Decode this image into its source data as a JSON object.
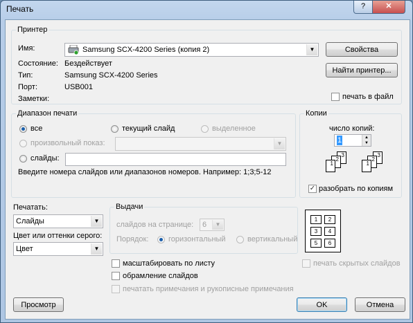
{
  "window": {
    "title": "Печать",
    "help_glyph": "?",
    "close_glyph": "✕"
  },
  "printer": {
    "legend": "Принтер",
    "name_label": "Имя:",
    "name_value": "Samsung SCX-4200 Series (копия 2)",
    "properties_button": "Свойства",
    "find_button": "Найти принтер...",
    "status_label": "Состояние:",
    "status_value": "Бездействует",
    "type_label": "Тип:",
    "type_value": "Samsung SCX-4200 Series",
    "port_label": "Порт:",
    "port_value": "USB001",
    "notes_label": "Заметки:",
    "print_to_file": "печать в файл"
  },
  "range": {
    "legend": "Диапазон печати",
    "all": "все",
    "current_slide": "текущий слайд",
    "selection": "выделенное",
    "custom_show": "произвольный показ:",
    "slides": "слайды:",
    "hint": "Введите номера слайдов или диапазонов номеров. Например: 1;3;5-12"
  },
  "copies": {
    "legend": "Копии",
    "count_label": "число копий:",
    "count_value": "1",
    "collate": "разобрать по копиям"
  },
  "print_what": {
    "label": "Печатать:",
    "value": "Слайды"
  },
  "color": {
    "label": "Цвет или оттенки серого:",
    "value": "Цвет"
  },
  "handouts": {
    "legend": "Выдачи",
    "per_page_label": "слайдов на странице:",
    "per_page_value": "6",
    "order_label": "Порядок:",
    "horizontal": "горизонтальный",
    "vertical": "вертикальный",
    "preview_numbers": [
      "1",
      "2",
      "3",
      "4",
      "5",
      "6"
    ]
  },
  "options": {
    "scale_to_fit": "масштабировать по листу",
    "frame_slides": "обрамление слайдов",
    "print_comments": "печатать примечания и рукописные примечания",
    "print_hidden": "печать скрытых слайдов"
  },
  "footer": {
    "preview_button": "Просмотр",
    "ok_button": "OK",
    "cancel_button": "Отмена"
  },
  "colors": {
    "accent": "#1b5fab",
    "close_button": "#c75050"
  }
}
